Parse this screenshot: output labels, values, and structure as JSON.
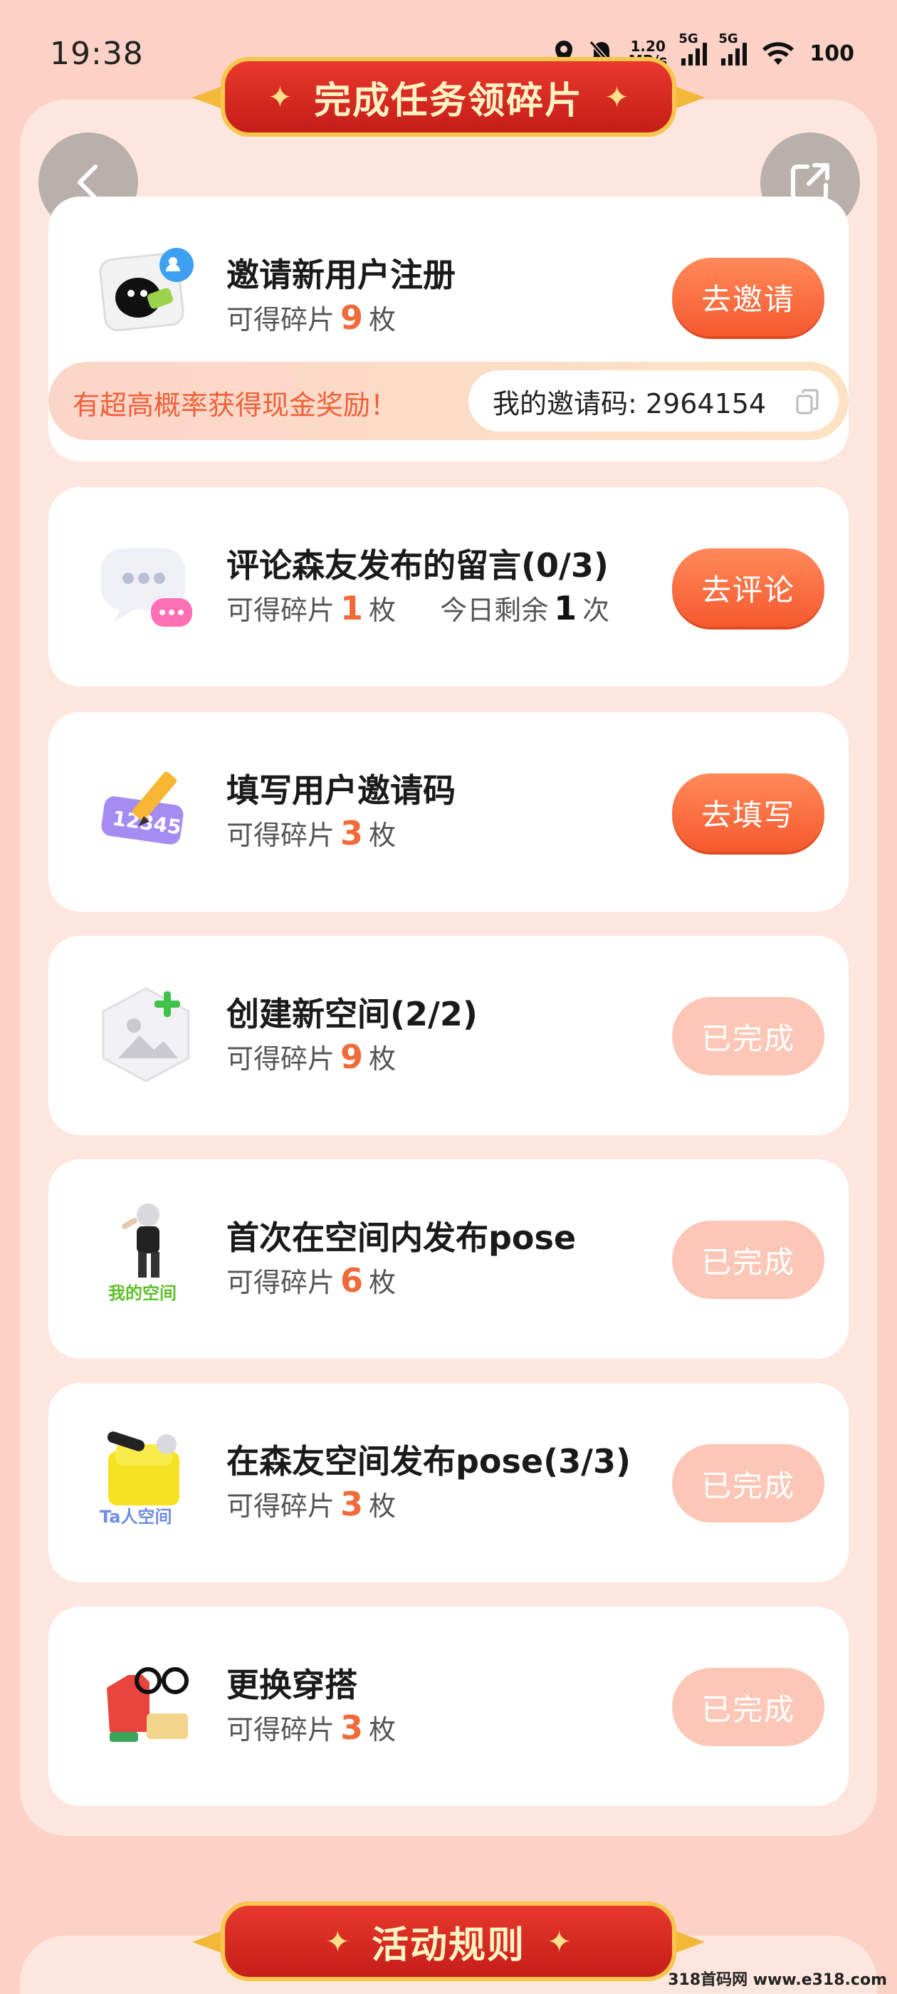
{
  "status": {
    "time": "19:38",
    "speed_value": "1.20",
    "speed_unit": "MB/s",
    "net1": "5G",
    "net2": "5G",
    "battery": "100"
  },
  "header": {
    "banner": "完成任务领碎片",
    "back_icon": "chevron-left-icon",
    "share_icon": "share-icon"
  },
  "tasks": [
    {
      "title": "邀请新用户注册",
      "sub_prefix": "可得碎片",
      "count": "9",
      "sub_suffix": "枚",
      "button": "去邀请",
      "state": "active",
      "icon": "invite-user-icon"
    },
    {
      "title": "评论森友发布的留言(0/3)",
      "sub_prefix": "可得碎片",
      "count": "1",
      "sub_suffix": "枚",
      "remain_prefix": "今日剩余",
      "remain_count": "1",
      "remain_suffix": "次",
      "button": "去评论",
      "state": "active",
      "icon": "comment-bubble-icon"
    },
    {
      "title": "填写用户邀请码",
      "sub_prefix": "可得碎片",
      "count": "3",
      "sub_suffix": "枚",
      "button": "去填写",
      "state": "active",
      "icon": "code-pencil-icon"
    },
    {
      "title": "创建新空间(2/2)",
      "sub_prefix": "可得碎片",
      "count": "9",
      "sub_suffix": "枚",
      "button": "已完成",
      "state": "done",
      "icon": "add-image-icon"
    },
    {
      "title": "首次在空间内发布pose",
      "sub_prefix": "可得碎片",
      "count": "6",
      "sub_suffix": "枚",
      "button": "已完成",
      "state": "done",
      "icon": "my-space-avatar-icon",
      "icon_caption": "我的空间"
    },
    {
      "title": "在森友空间发布pose(3/3)",
      "sub_prefix": "可得碎片",
      "count": "3",
      "sub_suffix": "枚",
      "button": "已完成",
      "state": "done",
      "icon": "ta-space-avatar-icon",
      "icon_caption": "Ta人空间"
    },
    {
      "title": "更换穿搭",
      "sub_prefix": "可得碎片",
      "count": "3",
      "sub_suffix": "枚",
      "button": "已完成",
      "state": "done",
      "icon": "outfit-icon"
    }
  ],
  "invite": {
    "promo": "有超高概率获得现金奖励！",
    "code_label": "我的邀请码: 2964154"
  },
  "rules": {
    "banner": "活动规则"
  },
  "watermark": "318首码网 www.e318.com",
  "colors": {
    "background": "#fbd2c5",
    "panel": "#fde6de",
    "accent": "#f5592e",
    "done_button": "#fcc7b6",
    "banner_red": "#d92a22",
    "banner_gold": "#f7c64c"
  }
}
